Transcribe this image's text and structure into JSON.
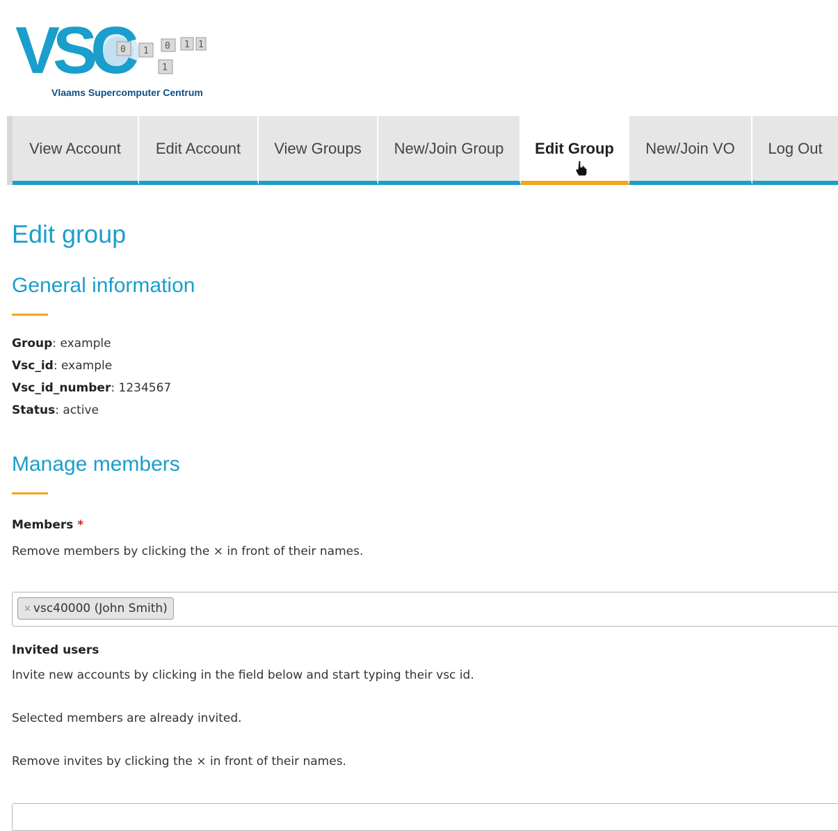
{
  "brand": {
    "logo_letters": "VSC",
    "tagline": "Vlaams Supercomputer Centrum",
    "colors": {
      "primary": "#1a9ecb",
      "dark": "#0e4f86",
      "accent": "#f3a51c"
    }
  },
  "nav": {
    "items": [
      {
        "label": "View Account"
      },
      {
        "label": "Edit Account"
      },
      {
        "label": "View Groups"
      },
      {
        "label": "New/Join Group"
      },
      {
        "label": "Edit Group",
        "active": true
      },
      {
        "label": "New/Join VO"
      },
      {
        "label": "Log Out"
      }
    ]
  },
  "page": {
    "title": "Edit group"
  },
  "general": {
    "title": "General information",
    "fields": [
      {
        "key": "Group",
        "value": "example"
      },
      {
        "key": "Vsc_id",
        "value": "example"
      },
      {
        "key": "Vsc_id_number",
        "value": "1234567"
      },
      {
        "key": "Status",
        "value": "active"
      }
    ]
  },
  "members": {
    "title": "Manage members",
    "label": "Members",
    "required_mark": "*",
    "help": "Remove members by clicking the × in front of their names.",
    "chips": [
      {
        "remove": "×",
        "text": "vsc40000 (John Smith)"
      }
    ]
  },
  "invited": {
    "label": "Invited users",
    "help1": "Invite new accounts by clicking in the field below and start typing their vsc id.",
    "help2": "Selected members are already invited.",
    "help3": "Remove invites by clicking the × in front of their names."
  },
  "icons": {
    "cursor": "hand-pointer-icon",
    "chip_remove": "close-icon"
  }
}
